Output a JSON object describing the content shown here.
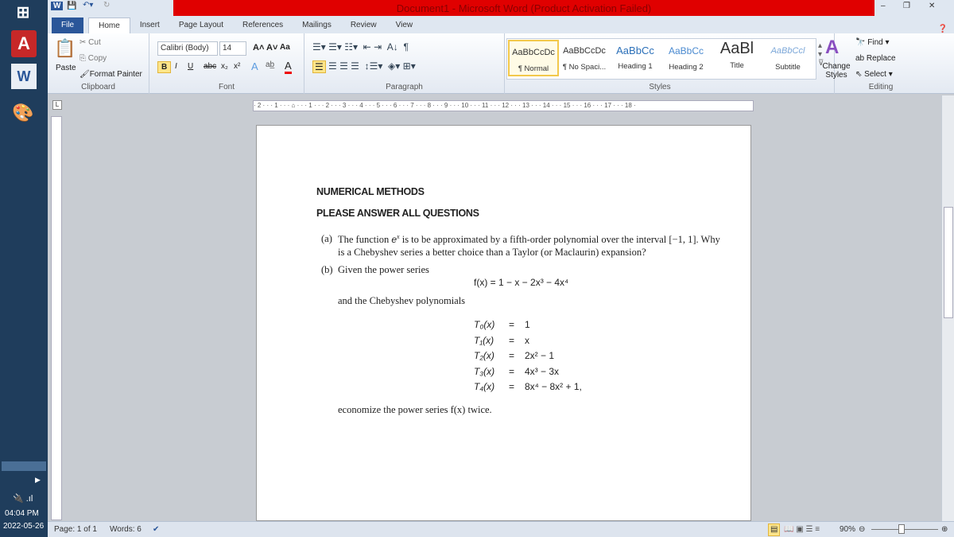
{
  "window": {
    "title": "Document1 - Microsoft Word (Product Activation Failed)"
  },
  "tabs": [
    "File",
    "Home",
    "Insert",
    "Page Layout",
    "References",
    "Mailings",
    "Review",
    "View"
  ],
  "clipboard": {
    "paste": "Paste",
    "cut": "Cut",
    "copy": "Copy",
    "format_painter": "Format Painter",
    "label": "Clipboard"
  },
  "font": {
    "name": "Calibri (Body)",
    "size": "14",
    "label": "Font",
    "bold": "B",
    "italic": "I",
    "underline": "U",
    "strike": "abc",
    "sub": "x₂",
    "sup": "x²",
    "case": "Aa"
  },
  "paragraph": {
    "label": "Paragraph"
  },
  "styles": {
    "label": "Styles",
    "items": [
      {
        "preview": "AaBbCcDc",
        "name": "¶ Normal"
      },
      {
        "preview": "AaBbCcDc",
        "name": "¶ No Spaci..."
      },
      {
        "preview": "AaBbCc",
        "name": "Heading 1"
      },
      {
        "preview": "AaBbCc",
        "name": "Heading 2"
      },
      {
        "preview": "AaBl",
        "name": "Title"
      },
      {
        "preview": "AaBbCcl",
        "name": "Subtitle"
      }
    ],
    "change": "Change Styles"
  },
  "editing": {
    "label": "Editing",
    "find": "Find",
    "replace": "Replace",
    "select": "Select"
  },
  "ruler": "· 2 · · · 1 · · · ⌂ · · · 1 · · · 2 · · · 3 · · · 4 · · · 5 · · · 6 · · · 7 · · · 8 · · · 9 · · · 10 · · · 11 · · · 12 · · · 13 · · · 14 · · · 15 · · · 16 · · · 17 · · · 18 ·",
  "document": {
    "heading1": "NUMERICAL METHODS",
    "heading2": "PLEASE ANSWER ALL QUESTIONS",
    "qa_label": "(a)",
    "qa_line1_pre": "The function ",
    "qa_line1_e": "e",
    "qa_line1_x": "x",
    "qa_line1_post": " is to be approximated by a fifth-order polynomial over the interval [−1, 1]. Why",
    "qa_line2": "is a Chebyshev series a better choice than a Taylor (or Maclaurin) expansion?",
    "qb_label": "(b)",
    "qb_line1": "Given the power series",
    "power_series": "f(x) = 1 − x − 2x³ − 4x⁴",
    "and_line": "and the Chebyshev polynomials",
    "chebyshev": [
      {
        "lhs": "T₀(x)",
        "rhs": "1"
      },
      {
        "lhs": "T₁(x)",
        "rhs": "x"
      },
      {
        "lhs": "T₂(x)",
        "rhs": "2x² − 1"
      },
      {
        "lhs": "T₃(x)",
        "rhs": "4x³ − 3x"
      },
      {
        "lhs": "T₄(x)",
        "rhs": "8x⁴ − 8x² + 1,"
      }
    ],
    "closing": "economize the power series f(x) twice."
  },
  "status": {
    "page": "Page: 1 of 1",
    "words": "Words: 6",
    "zoom": "90%"
  },
  "system": {
    "time": "04:04 PM",
    "date": "2022-05-26"
  }
}
